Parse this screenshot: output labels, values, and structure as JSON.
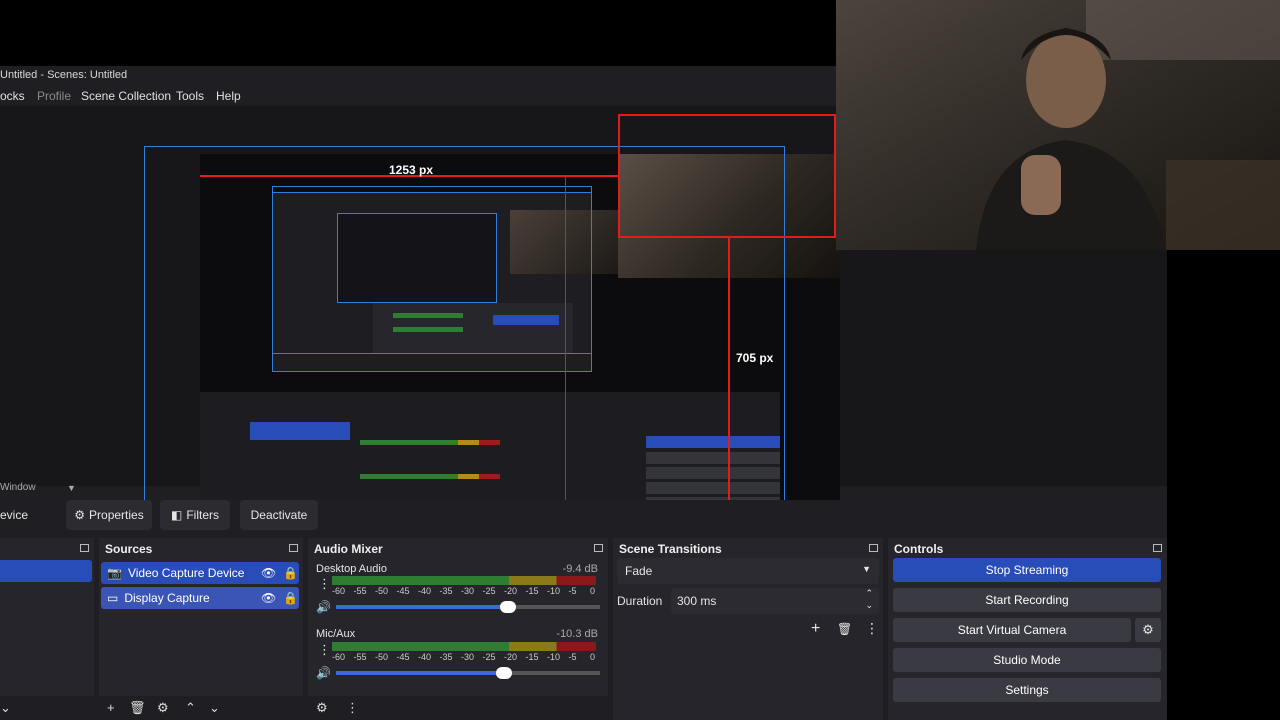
{
  "window_title": "Untitled - Scenes: Untitled",
  "menu": {
    "docks": "ocks",
    "profile": "Profile",
    "scene_collection": "Scene Collection",
    "tools": "Tools",
    "help": "Help"
  },
  "preview": {
    "width_label": "1253 px",
    "height_label": "705 px"
  },
  "scene_selector": {
    "value": "Window"
  },
  "toolbar": {
    "device_label": "evice",
    "properties_label": "Properties",
    "filters_label": "Filters",
    "deactivate_label": "Deactivate"
  },
  "sources": {
    "title": "Sources",
    "items": [
      {
        "label": "Video Capture Device",
        "icon": "camera-icon"
      },
      {
        "label": "Display Capture",
        "icon": "monitor-icon"
      }
    ]
  },
  "audio_mixer": {
    "title": "Audio Mixer",
    "channels": [
      {
        "name": "Desktop Audio",
        "level": "-9.4 dB",
        "volume": 0.64
      },
      {
        "name": "Mic/Aux",
        "level": "-10.3 dB",
        "volume": 0.61
      }
    ],
    "ticks": [
      "-60",
      "-55",
      "-50",
      "-45",
      "-40",
      "-35",
      "-30",
      "-25",
      "-20",
      "-15",
      "-10",
      "-5",
      "0"
    ]
  },
  "scene_transitions": {
    "title": "Scene Transitions",
    "transition": "Fade",
    "duration_label": "Duration",
    "duration_value": "300 ms"
  },
  "controls": {
    "title": "Controls",
    "stop_streaming": "Stop Streaming",
    "start_recording": "Start Recording",
    "start_virtual_camera": "Start Virtual Camera",
    "studio_mode": "Studio Mode",
    "settings": "Settings"
  },
  "colors": {
    "accent": "#284cb8",
    "guide_red": "#e21b1b",
    "guide_blue": "#2f7fe0",
    "panel": "#25252b",
    "background": "#1f1f23"
  }
}
